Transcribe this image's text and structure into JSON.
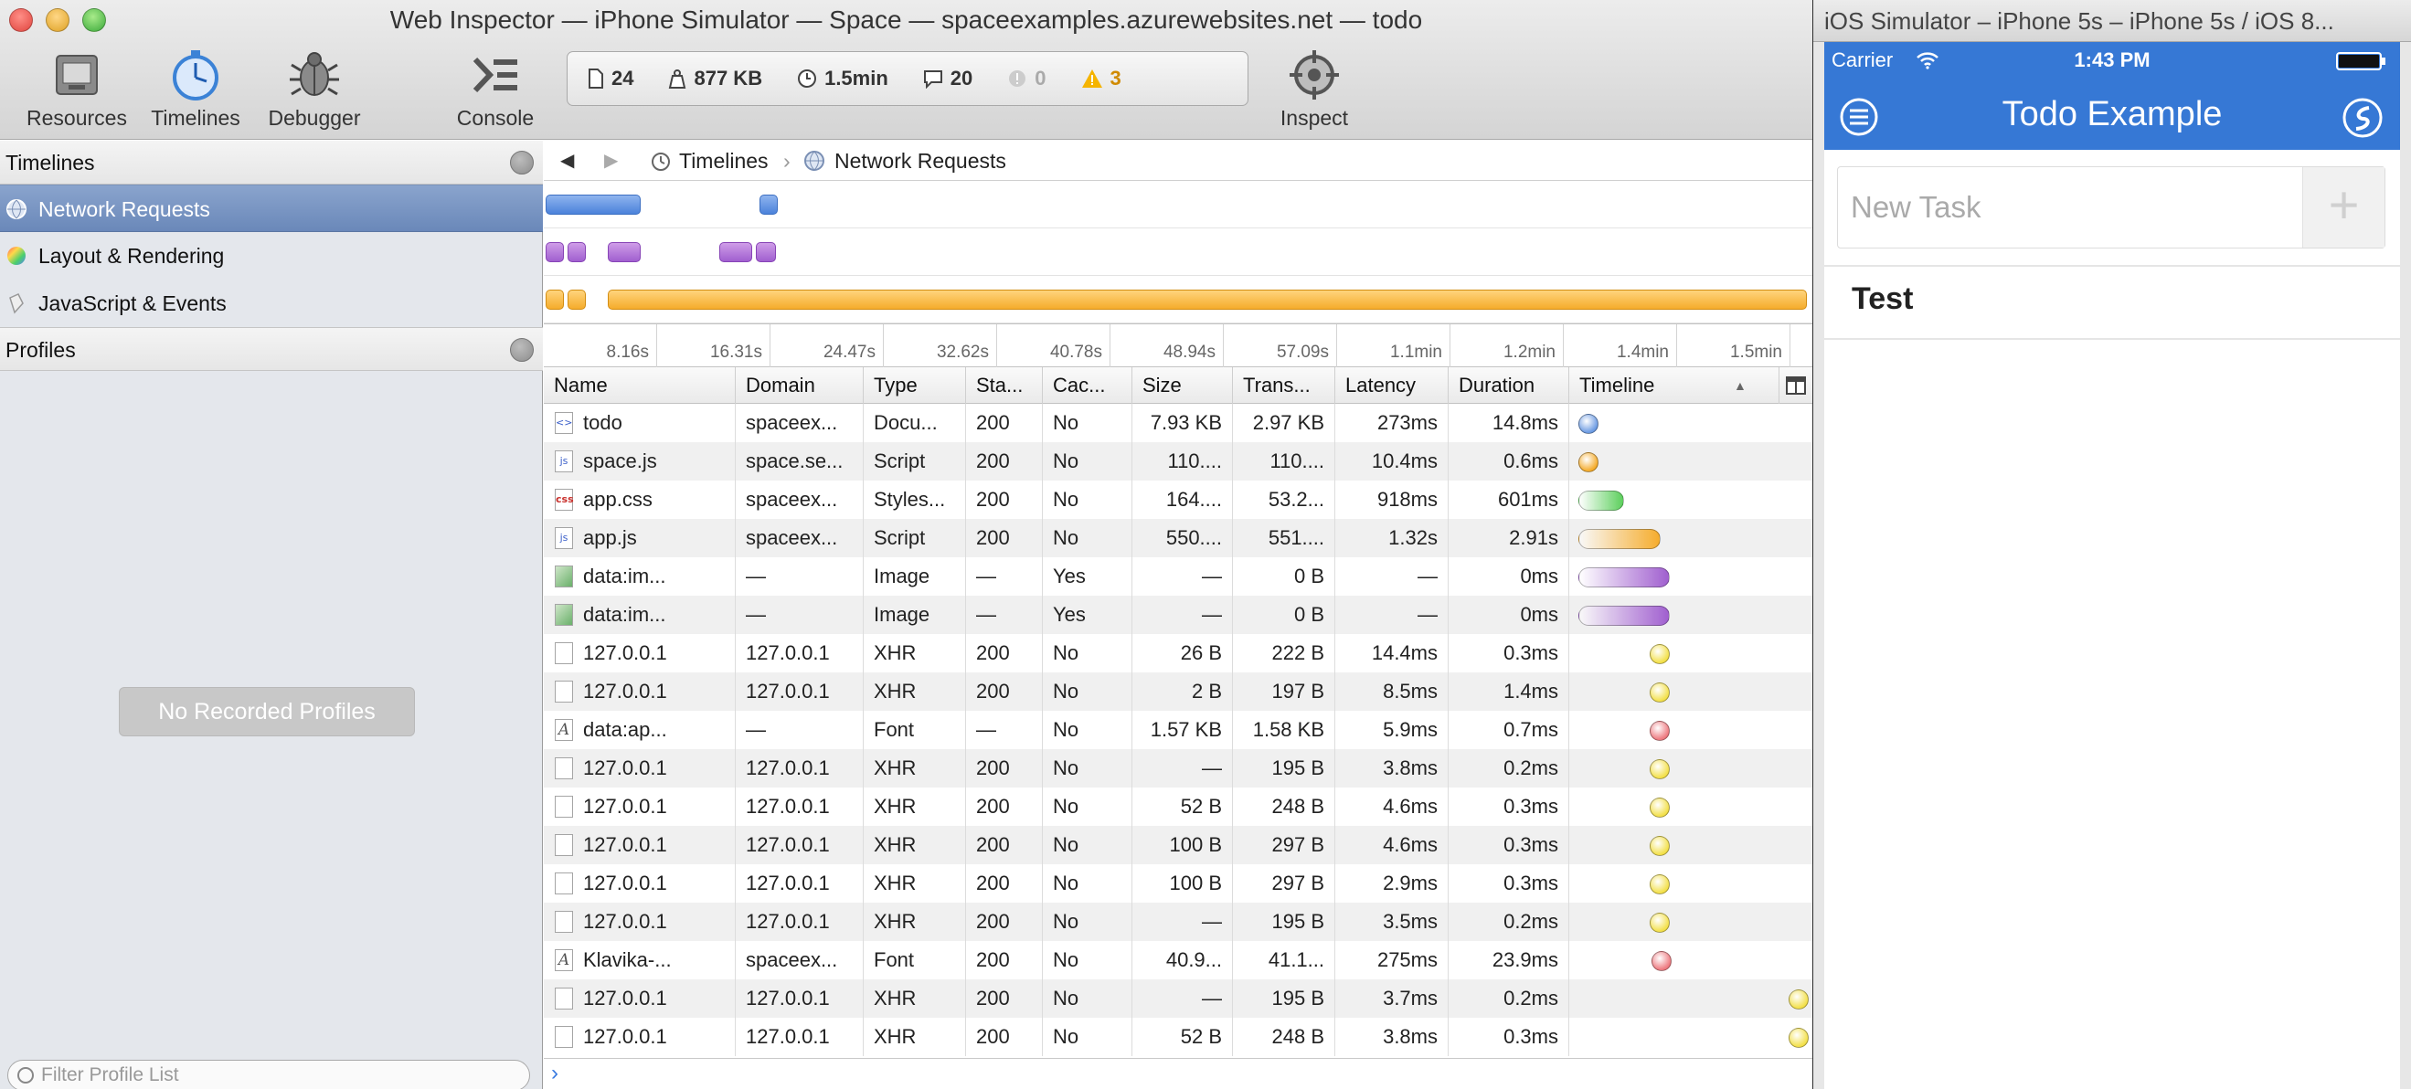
{
  "inspector": {
    "title": "Web Inspector — iPhone Simulator — Space — spaceexamples.azurewebsites.net — todo",
    "toolbar": {
      "resources": "Resources",
      "timelines": "Timelines",
      "debugger": "Debugger",
      "console": "Console",
      "inspect": "Inspect"
    },
    "status": {
      "resources_count": "24",
      "size": "877 KB",
      "duration": "1.5min",
      "messages": "20",
      "errors": "0",
      "warnings": "3"
    },
    "sidebar": {
      "timelines_header": "Timelines",
      "items": [
        {
          "label": "Network Requests"
        },
        {
          "label": "Layout & Rendering"
        },
        {
          "label": "JavaScript & Events"
        }
      ],
      "profiles_header": "Profiles",
      "no_profiles": "No Recorded Profiles",
      "filter_placeholder": "Filter Profile List"
    },
    "breadcrumb": {
      "back": "◀",
      "forward": "▶",
      "root": "Timelines",
      "current": "Network Requests"
    },
    "ruler_ticks": [
      "8.16s",
      "16.31s",
      "24.47s",
      "32.62s",
      "40.78s",
      "48.94s",
      "57.09s",
      "1.1min",
      "1.2min",
      "1.4min",
      "1.5min"
    ],
    "columns": [
      "Name",
      "Domain",
      "Type",
      "Sta...",
      "Cac...",
      "Size",
      "Trans...",
      "Latency",
      "Duration",
      "Timeline"
    ],
    "rows": [
      {
        "name": "todo",
        "domain": "spaceex...",
        "type": "Docu...",
        "status": "200",
        "cached": "No",
        "size": "7.93 KB",
        "transferred": "2.97 KB",
        "latency": "273ms",
        "duration": "14.8ms",
        "icon": "html-file-icon",
        "color": "#6c9be3"
      },
      {
        "name": "space.js",
        "domain": "space.se...",
        "type": "Script",
        "status": "200",
        "cached": "No",
        "size": "110....",
        "transferred": "110....",
        "latency": "10.4ms",
        "duration": "0.6ms",
        "icon": "js-file-icon",
        "color": "#f5ac2c"
      },
      {
        "name": "app.css",
        "domain": "spaceex...",
        "type": "Styles...",
        "status": "200",
        "cached": "No",
        "size": "164....",
        "transferred": "53.2...",
        "latency": "918ms",
        "duration": "601ms",
        "icon": "css-file-icon",
        "color": "#5ccf5c"
      },
      {
        "name": "app.js",
        "domain": "spaceex...",
        "type": "Script",
        "status": "200",
        "cached": "No",
        "size": "550....",
        "transferred": "551....",
        "latency": "1.32s",
        "duration": "2.91s",
        "icon": "js-file-icon",
        "color": "#f5ac2c"
      },
      {
        "name": "data:im...",
        "domain": "—",
        "type": "Image",
        "status": "—",
        "cached": "Yes",
        "size": "—",
        "transferred": "0 B",
        "latency": "—",
        "duration": "0ms",
        "icon": "image-file-icon",
        "color": "#a05fcf"
      },
      {
        "name": "data:im...",
        "domain": "—",
        "type": "Image",
        "status": "—",
        "cached": "Yes",
        "size": "—",
        "transferred": "0 B",
        "latency": "—",
        "duration": "0ms",
        "icon": "image-file-icon",
        "color": "#a05fcf"
      },
      {
        "name": "127.0.0.1",
        "domain": "127.0.0.1",
        "type": "XHR",
        "status": "200",
        "cached": "No",
        "size": "26 B",
        "transferred": "222 B",
        "latency": "14.4ms",
        "duration": "0.3ms",
        "icon": "blank-file-icon",
        "color": "#f3e04a"
      },
      {
        "name": "127.0.0.1",
        "domain": "127.0.0.1",
        "type": "XHR",
        "status": "200",
        "cached": "No",
        "size": "2 B",
        "transferred": "197 B",
        "latency": "8.5ms",
        "duration": "1.4ms",
        "icon": "blank-file-icon",
        "color": "#f3e04a"
      },
      {
        "name": "data:ap...",
        "domain": "—",
        "type": "Font",
        "status": "—",
        "cached": "No",
        "size": "1.57 KB",
        "transferred": "1.58 KB",
        "latency": "5.9ms",
        "duration": "0.7ms",
        "icon": "font-file-icon",
        "color": "#ee7a80"
      },
      {
        "name": "127.0.0.1",
        "domain": "127.0.0.1",
        "type": "XHR",
        "status": "200",
        "cached": "No",
        "size": "—",
        "transferred": "195 B",
        "latency": "3.8ms",
        "duration": "0.2ms",
        "icon": "blank-file-icon",
        "color": "#f3e04a"
      },
      {
        "name": "127.0.0.1",
        "domain": "127.0.0.1",
        "type": "XHR",
        "status": "200",
        "cached": "No",
        "size": "52 B",
        "transferred": "248 B",
        "latency": "4.6ms",
        "duration": "0.3ms",
        "icon": "blank-file-icon",
        "color": "#f3e04a"
      },
      {
        "name": "127.0.0.1",
        "domain": "127.0.0.1",
        "type": "XHR",
        "status": "200",
        "cached": "No",
        "size": "100 B",
        "transferred": "297 B",
        "latency": "4.6ms",
        "duration": "0.3ms",
        "icon": "blank-file-icon",
        "color": "#f3e04a"
      },
      {
        "name": "127.0.0.1",
        "domain": "127.0.0.1",
        "type": "XHR",
        "status": "200",
        "cached": "No",
        "size": "100 B",
        "transferred": "297 B",
        "latency": "2.9ms",
        "duration": "0.3ms",
        "icon": "blank-file-icon",
        "color": "#f3e04a"
      },
      {
        "name": "127.0.0.1",
        "domain": "127.0.0.1",
        "type": "XHR",
        "status": "200",
        "cached": "No",
        "size": "—",
        "transferred": "195 B",
        "latency": "3.5ms",
        "duration": "0.2ms",
        "icon": "blank-file-icon",
        "color": "#f3e04a"
      },
      {
        "name": "Klavika-...",
        "domain": "spaceex...",
        "type": "Font",
        "status": "200",
        "cached": "No",
        "size": "40.9...",
        "transferred": "41.1...",
        "latency": "275ms",
        "duration": "23.9ms",
        "icon": "font-file-icon",
        "color": "#ee7a80"
      },
      {
        "name": "127.0.0.1",
        "domain": "127.0.0.1",
        "type": "XHR",
        "status": "200",
        "cached": "No",
        "size": "—",
        "transferred": "195 B",
        "latency": "3.7ms",
        "duration": "0.2ms",
        "icon": "blank-file-icon",
        "color": "#f3e04a"
      },
      {
        "name": "127.0.0.1",
        "domain": "127.0.0.1",
        "type": "XHR",
        "status": "200",
        "cached": "No",
        "size": "52 B",
        "transferred": "248 B",
        "latency": "3.8ms",
        "duration": "0.3ms",
        "icon": "blank-file-icon",
        "color": "#f3e04a"
      }
    ]
  },
  "simulator": {
    "window_title": "iOS Simulator – iPhone 5s – iPhone 5s / iOS 8...",
    "carrier": "Carrier",
    "time": "1:43 PM",
    "app_title": "Todo Example",
    "new_task_placeholder": "New Task",
    "add_symbol": "+",
    "tasks": [
      "Test"
    ],
    "accent": "#3678d5"
  }
}
